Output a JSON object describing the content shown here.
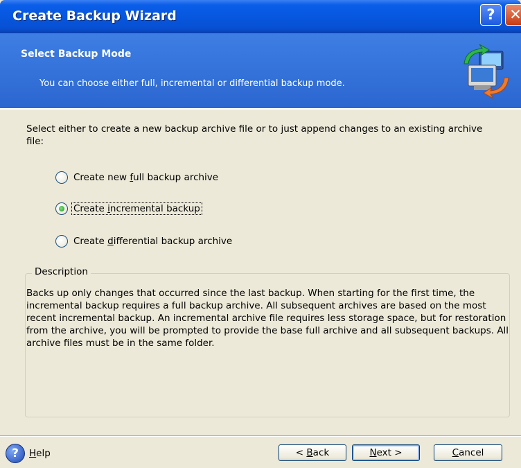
{
  "window": {
    "title": "Create Backup Wizard",
    "help_glyph": "?",
    "close_glyph": "✕"
  },
  "header": {
    "title": "Select Backup Mode",
    "subtitle": "You can choose either full, incremental or differential backup mode.",
    "icon": "backup-computer-icon"
  },
  "intro": "Select either to create a new backup archive file or to just append changes to an existing archive file:",
  "options": [
    {
      "label_pre": "Create new ",
      "label_key": "f",
      "label_post": "ull backup archive",
      "selected": false
    },
    {
      "label_pre": "Create ",
      "label_key": "i",
      "label_post": "ncremental backup",
      "selected": true
    },
    {
      "label_pre": "Create ",
      "label_key": "d",
      "label_post": "ifferential backup archive",
      "selected": false
    }
  ],
  "description": {
    "legend": "Description",
    "text": "Backs up only changes that occurred since the last backup. When starting for the first time, the incremental backup requires a full backup archive. All subsequent archives are based on the most recent incremental backup. An incremental archive file requires less storage space, but for restoration from the archive, you will be prompted to provide the base full archive and all subsequent backups. All archive files must be in the same folder."
  },
  "footer": {
    "help_icon": "?",
    "help_key": "H",
    "help_rest": "elp",
    "back_pre": "< ",
    "back_key": "B",
    "back_post": "ack",
    "next_key": "N",
    "next_post": "ext >",
    "cancel_key": "C",
    "cancel_post": "ancel"
  },
  "colors": {
    "titlebar": "#0757df",
    "header": "#3e7fe4",
    "window_bg": "#ece9d8"
  }
}
